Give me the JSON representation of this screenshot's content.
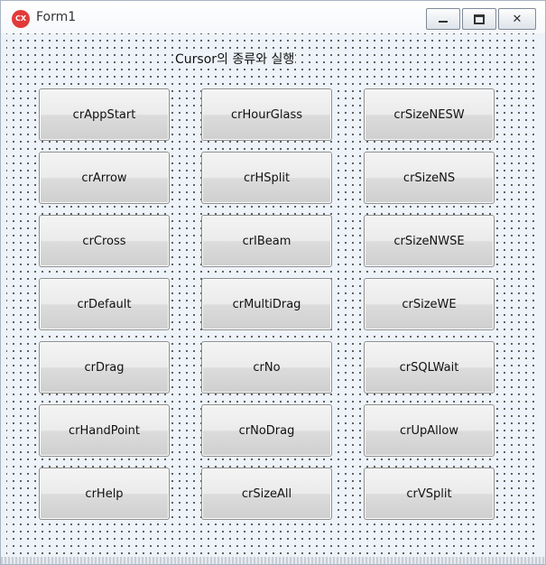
{
  "window": {
    "title": "Form1",
    "app_icon_text": "CX",
    "icons": {
      "app": "app-logo-icon",
      "minimize": "minimize-icon",
      "maximize": "maximize-icon",
      "close": "close-icon"
    }
  },
  "form": {
    "caption": "Cursor의 종류와 실행"
  },
  "buttons": [
    [
      "crAppStart",
      "crHourGlass",
      "crSizeNESW"
    ],
    [
      "crArrow",
      "crHSplit",
      "crSizeNS"
    ],
    [
      "crCross",
      "crIBeam",
      "crSizeNWSE"
    ],
    [
      "crDefault",
      "crMultiDrag",
      "crSizeWE"
    ],
    [
      "crDrag",
      "crNo",
      "crSQLWait"
    ],
    [
      "crHandPoint",
      "crNoDrag",
      "crUpAllow"
    ],
    [
      "crHelp",
      "crSizeAll",
      "crVSplit"
    ]
  ],
  "colors": {
    "window_bg": "#eef3f9",
    "app_icon": "#e23a3a",
    "button_border": "#8e8f8f"
  }
}
